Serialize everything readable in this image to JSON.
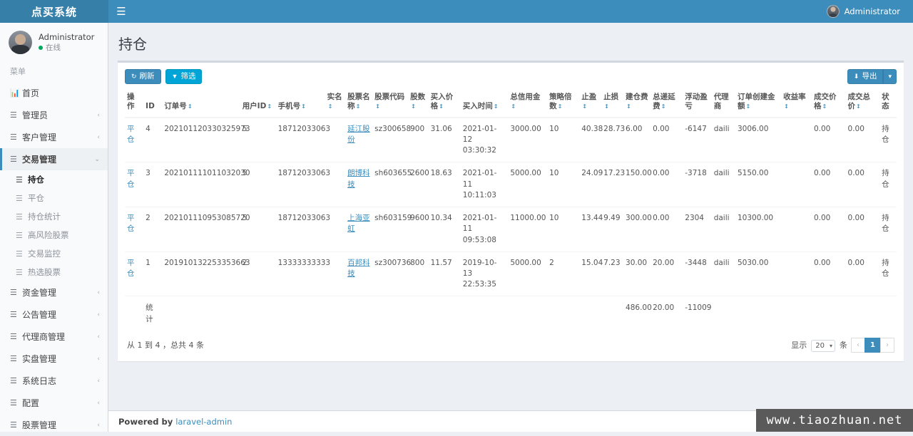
{
  "topbar": {
    "brand": "点买系统",
    "toggle_icon": "hamburger-icon",
    "user_name": "Administrator"
  },
  "sidebar": {
    "user_name": "Administrator",
    "user_status": "在线",
    "menu_header": "菜单",
    "items": [
      {
        "label": "首页",
        "icon": "chart-bar-icon",
        "arrow": "",
        "level": 0
      },
      {
        "label": "管理员",
        "icon": "list-icon",
        "arrow": "‹",
        "level": 0
      },
      {
        "label": "客户管理",
        "icon": "list-icon",
        "arrow": "‹",
        "level": 0
      },
      {
        "label": "交易管理",
        "icon": "bars-icon",
        "arrow": "⌄",
        "level": 0,
        "active_parent": true
      }
    ],
    "sub_items": [
      {
        "label": "持仓",
        "icon": "bars-icon",
        "active": true
      },
      {
        "label": "平仓",
        "icon": "bars-icon",
        "active": false
      },
      {
        "label": "持仓统计",
        "icon": "bars-icon",
        "active": false
      },
      {
        "label": "高风险股票",
        "icon": "bars-icon",
        "active": false
      },
      {
        "label": "交易监控",
        "icon": "bars-icon",
        "active": false
      },
      {
        "label": "热选股票",
        "icon": "bars-icon",
        "active": false
      }
    ],
    "items_after": [
      {
        "label": "资金管理",
        "icon": "bars-icon",
        "arrow": "‹"
      },
      {
        "label": "公告管理",
        "icon": "bars-icon",
        "arrow": "‹"
      },
      {
        "label": "代理商管理",
        "icon": "bars-icon",
        "arrow": "‹"
      },
      {
        "label": "实盘管理",
        "icon": "bars-icon",
        "arrow": "‹"
      },
      {
        "label": "系统日志",
        "icon": "bars-icon",
        "arrow": "‹"
      },
      {
        "label": "配置",
        "icon": "bars-icon",
        "arrow": "‹"
      },
      {
        "label": "股票管理",
        "icon": "bars-icon",
        "arrow": "‹"
      }
    ]
  },
  "page": {
    "title": "持仓"
  },
  "toolbar": {
    "refresh_label": "刷新",
    "refresh_icon": "refresh-icon",
    "filter_label": "筛选",
    "filter_icon": "funnel-icon",
    "export_label": "导出",
    "export_icon": "download-icon",
    "export_caret_icon": "caret-down-icon"
  },
  "table": {
    "columns": [
      {
        "label": "操作",
        "sortable": false
      },
      {
        "label": "ID",
        "sortable": false
      },
      {
        "label": "订单号",
        "sortable": true
      },
      {
        "label": "用户ID",
        "sortable": true
      },
      {
        "label": "手机号",
        "sortable": true
      },
      {
        "label": "实名",
        "sortable": true
      },
      {
        "label": "股票名称",
        "sortable": true
      },
      {
        "label": "股票代码",
        "sortable": true
      },
      {
        "label": "股数",
        "sortable": true
      },
      {
        "label": "买入价格",
        "sortable": true
      },
      {
        "label": "买入时间",
        "sortable": true
      },
      {
        "label": "总信用金",
        "sortable": true
      },
      {
        "label": "策略倍数",
        "sortable": true
      },
      {
        "label": "止盈",
        "sortable": true
      },
      {
        "label": "止损",
        "sortable": true
      },
      {
        "label": "建仓费",
        "sortable": true
      },
      {
        "label": "总递延费",
        "sortable": true
      },
      {
        "label": "浮动盈亏",
        "sortable": false
      },
      {
        "label": "代理商",
        "sortable": false
      },
      {
        "label": "订单创建金额",
        "sortable": true
      },
      {
        "label": "收益率",
        "sortable": true
      },
      {
        "label": "成交价格",
        "sortable": true
      },
      {
        "label": "成交总价",
        "sortable": true
      },
      {
        "label": "状态",
        "sortable": false
      }
    ],
    "action_label": "平仓",
    "rows": [
      {
        "id": "4",
        "order_no": "202101120330325973",
        "user_id": "5",
        "phone": "18712033063",
        "real_name": "",
        "stock_name": "延江股份",
        "stock_code": "sz300658",
        "shares": "900",
        "buy_price": "31.06",
        "buy_time": "2021-01-12 03:30:32",
        "total_credit": "3000.00",
        "leverage": "10",
        "take_profit": "40.38",
        "stop_loss": "28.73",
        "open_fee": "6.00",
        "deferred_fee": "0.00",
        "floating_pl": "-6147",
        "agent": "daili",
        "order_amount": "3006.00",
        "yield_rate": "",
        "deal_price": "0.00",
        "deal_total": "0.00",
        "status": "持仓"
      },
      {
        "id": "3",
        "order_no": "202101111011032030",
        "user_id": "5",
        "phone": "18712033063",
        "real_name": "",
        "stock_name": "朗博科技",
        "stock_code": "sh603655",
        "shares": "2600",
        "buy_price": "18.63",
        "buy_time": "2021-01-11 10:11:03",
        "total_credit": "5000.00",
        "leverage": "10",
        "take_profit": "24.09",
        "stop_loss": "17.23",
        "open_fee": "150.00",
        "deferred_fee": "0.00",
        "floating_pl": "-3718",
        "agent": "daili",
        "order_amount": "5150.00",
        "yield_rate": "",
        "deal_price": "0.00",
        "deal_total": "0.00",
        "status": "持仓"
      },
      {
        "id": "2",
        "order_no": "202101110953085720",
        "user_id": "5",
        "phone": "18712033063",
        "real_name": "",
        "stock_name": "上海亚虹",
        "stock_code": "sh603159",
        "shares": "9600",
        "buy_price": "10.34",
        "buy_time": "2021-01-11 09:53:08",
        "total_credit": "11000.00",
        "leverage": "10",
        "take_profit": "13.44",
        "stop_loss": "9.49",
        "open_fee": "300.00",
        "deferred_fee": "0.00",
        "floating_pl": "2304",
        "agent": "daili",
        "order_amount": "10300.00",
        "yield_rate": "",
        "deal_price": "0.00",
        "deal_total": "0.00",
        "status": "持仓"
      },
      {
        "id": "1",
        "order_no": "201910132253353663",
        "user_id": "2",
        "phone": "13333333333",
        "real_name": "",
        "stock_name": "百邦科技",
        "stock_code": "sz300736",
        "shares": "800",
        "buy_price": "11.57",
        "buy_time": "2019-10-13 22:53:35",
        "total_credit": "5000.00",
        "leverage": "2",
        "take_profit": "15.04",
        "stop_loss": "7.23",
        "open_fee": "30.00",
        "deferred_fee": "20.00",
        "floating_pl": "-3448",
        "agent": "daili",
        "order_amount": "5030.00",
        "yield_rate": "",
        "deal_price": "0.00",
        "deal_total": "0.00",
        "status": "持仓"
      }
    ],
    "total_row": {
      "label": "统计",
      "open_fee": "486.00",
      "deferred_fee": "20.00",
      "floating_pl": "-11009"
    }
  },
  "pagination": {
    "summary": "从 1 到 4 ，总共 4 条",
    "show_label": "显示",
    "per_page": "20",
    "unit_label": "条",
    "prev_icon": "chevron-left-icon",
    "next_icon": "chevron-right-icon",
    "current_page": "1"
  },
  "footer": {
    "powered_by": "Powered by",
    "link": "laravel-admin",
    "watermark": "www.tiaozhuan.net"
  }
}
